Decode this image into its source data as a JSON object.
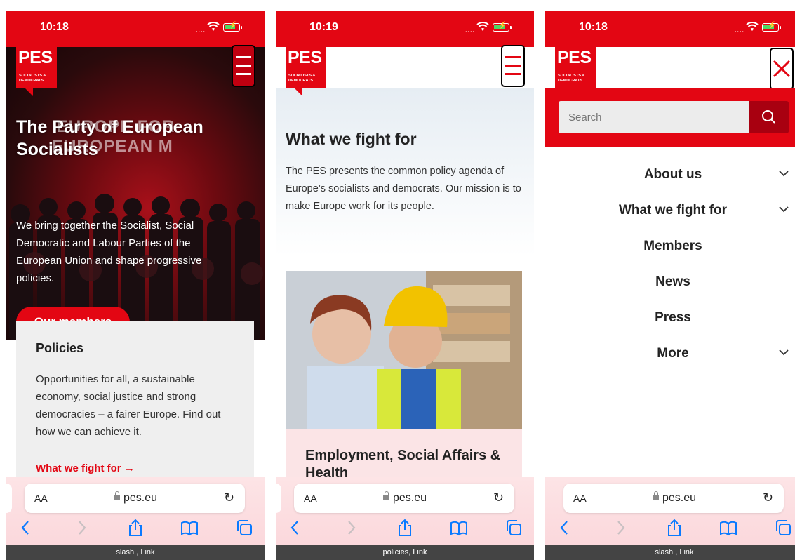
{
  "screens": [
    {
      "time": "10:18",
      "logo": {
        "main": "PES",
        "sub_line1": "SOCIALISTS &",
        "sub_line2": "DEMOCRATS"
      },
      "hero": {
        "banner": "'EUROPE FOR EUROPEAN M",
        "title": "The Party of European Socialists",
        "description": "We bring together the Socialist, Social Democratic and Labour Parties of the European Union and shape progressive policies.",
        "button": "Our members"
      },
      "policies": {
        "title": "Policies",
        "description": "Opportunities for all, a sustainable economy, social justice and strong democracies – a fairer Europe. Find out how we can achieve it.",
        "link": "What we fight for →"
      },
      "browser": {
        "aa": "AA",
        "url": "pes.eu",
        "status": "slash , Link"
      }
    },
    {
      "time": "10:19",
      "logo": {
        "main": "PES",
        "sub_line1": "SOCIALISTS &",
        "sub_line2": "DEMOCRATS"
      },
      "fight": {
        "title": "What we fight for",
        "description": "The PES presents the common policy agenda of Europe’s socialists and democrats. Our mission is to make Europe work for its people."
      },
      "card": {
        "title": "Employment, Social Affairs & Health"
      },
      "browser": {
        "aa": "AA",
        "url": "pes.eu",
        "status": "policies, Link"
      }
    },
    {
      "time": "10:18",
      "logo": {
        "main": "PES",
        "sub_line1": "SOCIALISTS &",
        "sub_line2": "DEMOCRATS"
      },
      "search": {
        "placeholder": "Search"
      },
      "nav": [
        {
          "label": "About us",
          "has_chevron": true
        },
        {
          "label": "What we fight for",
          "has_chevron": true
        },
        {
          "label": "Members",
          "has_chevron": false
        },
        {
          "label": "News",
          "has_chevron": false
        },
        {
          "label": "Press",
          "has_chevron": false
        },
        {
          "label": "More",
          "has_chevron": true
        }
      ],
      "browser": {
        "aa": "AA",
        "url": "pes.eu",
        "status": "slash , Link"
      }
    }
  ],
  "colors": {
    "brand_red": "#e30613",
    "dark_red": "#a80010",
    "link_blue": "#0a7aff"
  },
  "icons": [
    "wifi-icon",
    "battery-icon",
    "hamburger-icon",
    "close-icon",
    "search-icon",
    "chevron-down-icon",
    "lock-icon",
    "reload-icon",
    "back-icon",
    "forward-icon",
    "share-icon",
    "bookmarks-icon",
    "tabs-icon"
  ]
}
